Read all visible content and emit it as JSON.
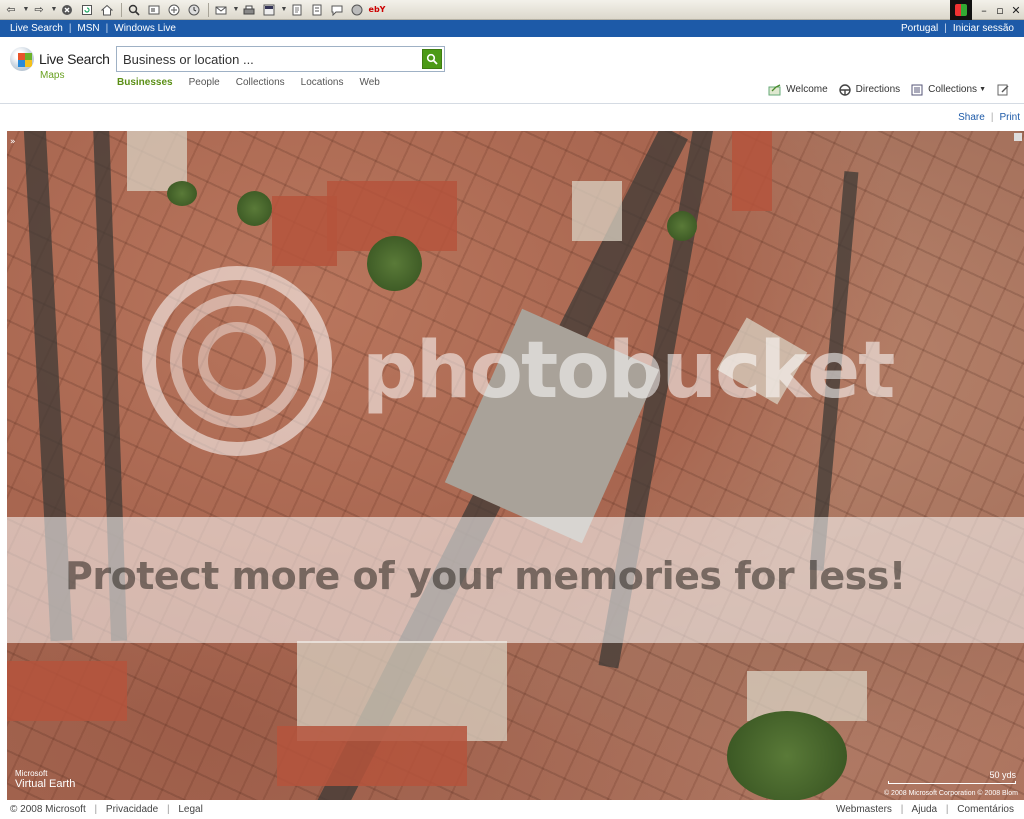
{
  "browser": {
    "toolbar_icons": [
      "back-icon",
      "forward-icon",
      "stop-icon",
      "refresh-icon",
      "home-icon",
      "search-icon",
      "favorites-icon",
      "media-icon",
      "history-icon",
      "mail-icon",
      "print-icon",
      "edit-icon",
      "discuss-icon",
      "messenger-icon",
      "research-icon",
      "ebay-icon"
    ],
    "back_glyph": "⇦",
    "forward_glyph": "⇨",
    "ebay_label": "ebY"
  },
  "topbar": {
    "links": [
      "Live Search",
      "MSN",
      "Windows Live"
    ],
    "right_links": [
      "Portugal",
      "Iniciar sessão"
    ]
  },
  "header": {
    "logo_text": "Live Search",
    "logo_sub": "Maps",
    "search_placeholder": "Business or location ...",
    "search_value": "",
    "scope_tabs": [
      {
        "label": "Businesses",
        "active": true
      },
      {
        "label": "People",
        "active": false
      },
      {
        "label": "Collections",
        "active": false
      },
      {
        "label": "Locations",
        "active": false
      },
      {
        "label": "Web",
        "active": false
      }
    ],
    "actions": {
      "welcome": "Welcome",
      "directions": "Directions",
      "collections": "Collections"
    },
    "share": "Share",
    "print": "Print"
  },
  "map": {
    "collapse_glyph": "»",
    "watermark": "photobucket",
    "promo": "Protect more of your memories for less!",
    "logo_ms": "Microsoft",
    "logo_ve": "Virtual Earth",
    "scale_label": "50 yds",
    "copyright": "© 2008 Microsoft Corporation   © 2008 Blom"
  },
  "footer": {
    "left": [
      "© 2008 Microsoft",
      "Privacidade",
      "Legal"
    ],
    "right": [
      "Webmasters",
      "Ajuda",
      "Comentários"
    ]
  },
  "colors": {
    "topbar": "#1d5aa8",
    "accent_green": "#5b8f16",
    "link_blue": "#1d5aa8"
  }
}
